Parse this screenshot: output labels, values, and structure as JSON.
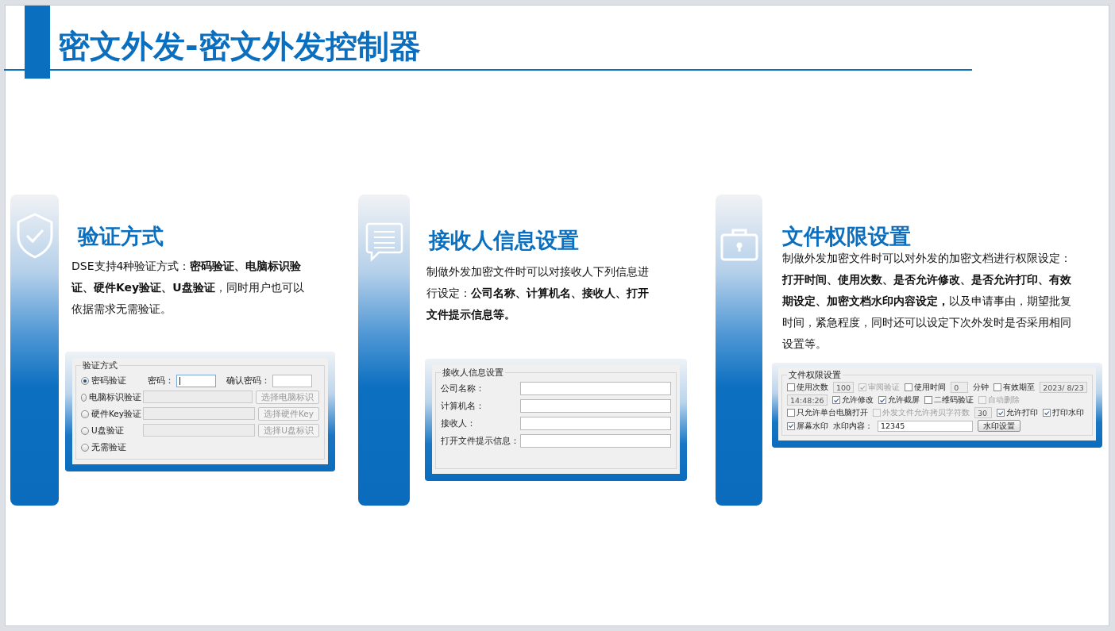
{
  "title": "密文外发-密文外发控制器",
  "cards": [
    {
      "heading": "验证方式",
      "text": "DSE支持4种验证方式：**密码验证、电脑标识验证、硬件Key验证、U盘验证**，同时用户也可以依据需求无需验证。",
      "dialog": {
        "kind": "auth",
        "group_title": "验证方式",
        "rows": [
          {
            "kind": "password",
            "label": "密码验证",
            "selected": true,
            "fields": [
              {
                "label": "密码：",
                "focused": true
              },
              {
                "label": "确认密码：",
                "focused": false
              }
            ]
          },
          {
            "kind": "picker",
            "label": "电脑标识验证",
            "selected": false,
            "button": "选择电脑标识"
          },
          {
            "kind": "picker",
            "label": "硬件Key验证",
            "selected": false,
            "button": "选择硬件Key"
          },
          {
            "kind": "picker",
            "label": "U盘验证",
            "selected": false,
            "button": "选择U盘标识"
          },
          {
            "kind": "plain",
            "label": "无需验证",
            "selected": false
          }
        ]
      }
    },
    {
      "heading": "接收人信息设置",
      "text": "制做外发加密文件时可以对接收人下列信息进行设定：**公司名称、计算机名、接收人、打开文件提示信息等。**",
      "dialog": {
        "kind": "form",
        "group_title": "接收人信息设置",
        "fields": [
          {
            "label": "公司名称："
          },
          {
            "label": "计算机名："
          },
          {
            "label": "接收人："
          },
          {
            "label": "打开文件提示信息："
          }
        ]
      }
    },
    {
      "heading": "文件权限设置",
      "text": "制做外发加密文件时可以对外发的加密文档进行权限设定：**打开时间、使用次数、是否允许修改、是否允许打印、有效期设定、加密文档水印内容设定，**以及申请事由，期望批复时间，紧急程度，同时还可以设定下次外发时是否采用相同设置等。",
      "dialog": {
        "kind": "permissions",
        "group_title": "文件权限设置",
        "controls": [
          {
            "kind": "checkbox",
            "label": "使用次数",
            "checked": false,
            "disabled": false
          },
          {
            "kind": "field",
            "value": "100",
            "disabled": true
          },
          {
            "kind": "checkbox",
            "label": "审阅验证",
            "checked": true,
            "disabled": true
          },
          {
            "kind": "checkbox",
            "label": "使用时间",
            "checked": false,
            "disabled": false
          },
          {
            "kind": "field",
            "value": "0",
            "disabled": true
          },
          {
            "kind": "text",
            "label": "分钟"
          },
          {
            "kind": "checkbox",
            "label": "有效期至",
            "checked": false,
            "disabled": false
          },
          {
            "kind": "field",
            "value": "2023/ 8/23",
            "disabled": true
          },
          {
            "kind": "field",
            "value": "14:48:26",
            "disabled": true
          },
          {
            "kind": "checkbox",
            "label": "允许修改",
            "checked": true,
            "disabled": false
          },
          {
            "kind": "checkbox",
            "label": "允许截屏",
            "checked": true,
            "disabled": false
          },
          {
            "kind": "checkbox",
            "label": "二维码验证",
            "checked": false,
            "disabled": false
          },
          {
            "kind": "checkbox",
            "label": "自动删除",
            "checked": false,
            "disabled": true
          },
          {
            "kind": "checkbox",
            "label": "只允许单台电脑打开",
            "checked": false,
            "disabled": false
          },
          {
            "kind": "checkbox",
            "label": "外发文件允许拷贝字符数",
            "checked": false,
            "disabled": true
          },
          {
            "kind": "field",
            "value": "30",
            "disabled": true
          },
          {
            "kind": "checkbox",
            "label": "允许打印",
            "checked": true,
            "disabled": false
          },
          {
            "kind": "checkbox",
            "label": "打印水印",
            "checked": true,
            "disabled": false
          },
          {
            "kind": "checkbox",
            "label": "屏幕水印",
            "checked": true,
            "disabled": false
          },
          {
            "kind": "text",
            "label": "水印内容："
          },
          {
            "kind": "field",
            "value": "12345",
            "disabled": false
          },
          {
            "kind": "button",
            "label": "水印设置"
          }
        ]
      }
    }
  ]
}
